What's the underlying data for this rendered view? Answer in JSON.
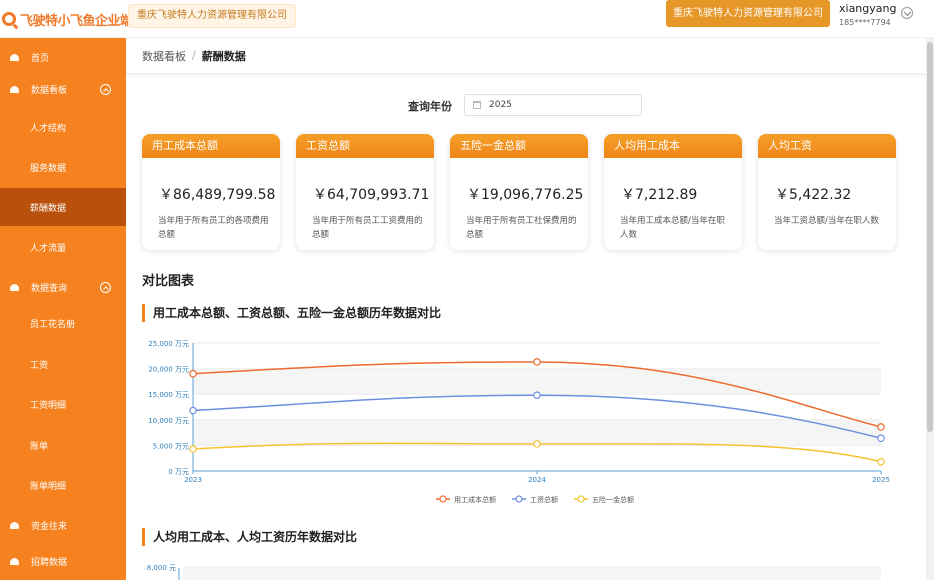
{
  "header": {
    "logo_text": "飞驶特小飞鱼企业端",
    "company_tag": "重庆飞驶特人力资源管理有限公司",
    "company_button": "重庆飞驶特人力资源管理有限公司",
    "user_name": "xiangyang",
    "user_phone": "185****7794"
  },
  "sidebar": {
    "items": [
      {
        "label": "首页",
        "type": "parent",
        "icon": "home-icon"
      },
      {
        "label": "数据看板",
        "type": "parent",
        "icon": "dashboard-icon",
        "expandable": true
      },
      {
        "label": "人才结构",
        "type": "child"
      },
      {
        "label": "服务数据",
        "type": "child"
      },
      {
        "label": "薪酬数据",
        "type": "child",
        "active": true
      },
      {
        "label": "人才流量",
        "type": "child"
      },
      {
        "label": "数据查询",
        "type": "parent",
        "icon": "query-icon",
        "expandable": true
      },
      {
        "label": "员工花名册",
        "type": "child"
      },
      {
        "label": "工资",
        "type": "child"
      },
      {
        "label": "工资明细",
        "type": "child"
      },
      {
        "label": "账单",
        "type": "child"
      },
      {
        "label": "账单明细",
        "type": "child"
      },
      {
        "label": "资金往来",
        "type": "parent",
        "icon": "funds-icon"
      },
      {
        "label": "招聘数据",
        "type": "parent",
        "icon": "recruit-icon"
      }
    ]
  },
  "breadcrumb": {
    "parent": "数据看板",
    "separator": "/",
    "current": "薪酬数据"
  },
  "query": {
    "label": "查询年份",
    "value": "2025"
  },
  "cards": [
    {
      "title": "用工成本总额",
      "value": "￥86,489,799.58",
      "desc": "当年用于所有员工的各项费用总额"
    },
    {
      "title": "工资总额",
      "value": "￥64,709,993.71",
      "desc": "当年用于所有员工工资费用的总额"
    },
    {
      "title": "五险一金总额",
      "value": "￥19,096,776.25",
      "desc": "当年用于所有员工社保费用的总额"
    },
    {
      "title": "人均用工成本",
      "value": "￥7,212.89",
      "desc": "当年用工成本总额/当年在职人数"
    },
    {
      "title": "人均工资",
      "value": "￥5,422.32",
      "desc": "当年工资总额/当年在职人数"
    }
  ],
  "section_title": "对比图表",
  "chart1_title": "用工成本总额、工资总额、五险一金总额历年数据对比",
  "chart2_title": "人均用工成本、人均工资历年数据对比",
  "chart_data": [
    {
      "type": "line",
      "title": "用工成本总额、工资总额、五险一金总额历年数据对比",
      "x": [
        "2023",
        "2024",
        "2025"
      ],
      "ylim": [
        0,
        25000
      ],
      "y_ticks": [
        "0 万元",
        "5,000 万元",
        "10,000 万元",
        "15,000 万元",
        "20,000 万元",
        "25,000 万元"
      ],
      "grid": true,
      "legend_position": "bottom-center",
      "series": [
        {
          "name": "用工成本总额",
          "values": [
            19000,
            21300,
            8600
          ],
          "color": "#ee6a30"
        },
        {
          "name": "工资总额",
          "values": [
            11800,
            14800,
            6400
          ],
          "color": "#6c8ee0"
        },
        {
          "name": "五险一金总额",
          "values": [
            4300,
            5300,
            1800
          ],
          "color": "#f2c230"
        }
      ]
    },
    {
      "type": "line",
      "title": "人均用工成本、人均工资历年数据对比",
      "y_ticks": [
        "8,000 元"
      ]
    }
  ]
}
